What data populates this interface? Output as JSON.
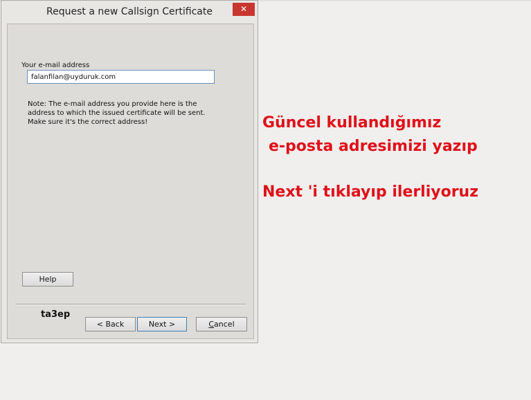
{
  "window": {
    "title": "Request a new Callsign Certificate",
    "close_glyph": "✕"
  },
  "form": {
    "email_label": "Your e-mail address",
    "email_value": "falanfilan@uyduruk.com",
    "note_lines": [
      "Note: The e-mail address you provide here is the",
      "address to which the issued certificate will be sent.",
      "Make sure it's the correct address!"
    ]
  },
  "buttons": {
    "help": "Help",
    "back": "< Back",
    "next": "Next >",
    "cancel": "Cancel"
  },
  "brand": "ta3ep",
  "annotation": {
    "line1": "Güncel kullandığımız",
    "line2": "e-posta adresimizi yazıp",
    "line3": "Next 'i tıklayıp ilerliyoruz",
    "color": "#e0101a"
  }
}
